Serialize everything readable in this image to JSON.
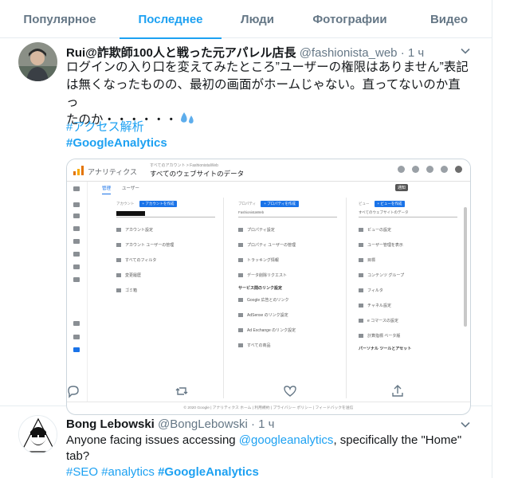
{
  "tabs": [
    "Популярное",
    "Последнее",
    "Люди",
    "Фотографии",
    "Видео"
  ],
  "active_tab": 1,
  "tweet1": {
    "name": "Rui@詐欺師100人と戦った元アパレル店長",
    "handle": "@fashionista_web",
    "time": "· 1 ч",
    "text_line1": "ログインの入り口を変えてみたところ”ユーザーの権限はありません”表記",
    "text_line2": "は無くなったものの、最初の画面がホームじゃない。直ってないのか直っ",
    "text_line3": "たのか・・・・・・",
    "emoji": "sweat-droplets",
    "hashtag1": "#アクセス解析",
    "hashtag2": "#GoogleAnalytics",
    "media": {
      "app_name": "アナリティクス",
      "breadcrumb": "すべてのアカウント > FashionistaWeb",
      "view_name": "すべてのウェブサイトのデータ",
      "tooltip": "通知",
      "tabs": [
        "管理",
        "ユーザー"
      ],
      "col_account": {
        "label": "アカウント",
        "button": "+ アカウントを作成",
        "items": [
          "アカウント設定",
          "アカウント ユーザーの管理",
          "すべてのフィルタ",
          "変更履歴",
          "ゴミ箱"
        ]
      },
      "col_property": {
        "label": "プロパティ",
        "button": "+ プロパティを作成",
        "select": "FashionistaWeb",
        "items": [
          "プロパティ設定",
          "プロパティ ユーザーの管理",
          "トラッキング情報",
          "データ削除リクエスト"
        ],
        "section": "サービス間のリンク設定",
        "links": [
          "Google 広告とのリンク",
          "AdSense のリンク設定",
          "Ad Exchange のリンク設定",
          "すべての商品"
        ]
      },
      "col_view": {
        "label": "ビュー",
        "button": "+ ビューを作成",
        "select": "すべてのウェブサイトのデータ",
        "items": [
          "ビューの設定",
          "ユーザー管理を表示",
          "目標",
          "コンテンツ グループ",
          "フィルタ",
          "チャネル設定",
          "e コマースの設定",
          "計算指標 ベータ版"
        ],
        "section": "パーソナル ツールとアセット"
      },
      "footer": "© 2020 Google | アナリティクス ホーム | 利用規約 | プライバシー ポリシー | フィードバックを送信"
    }
  },
  "tweet2": {
    "name": "Bong Lebowski",
    "handle": "@BongLebowski",
    "time": "· 1 ч",
    "text_before": "Anyone facing issues accessing ",
    "mention": "@googleanalytics",
    "text_after": ", specifically the \"Home\"",
    "text_line2": "tab?",
    "hashtag1": "#SEO",
    "hashtag2": "#analytics",
    "hashtag3": "#GoogleAnalytics"
  },
  "colors": {
    "accent": "#1da1f2",
    "text": "#14171a",
    "muted": "#657786",
    "border": "#e6ecf0"
  }
}
